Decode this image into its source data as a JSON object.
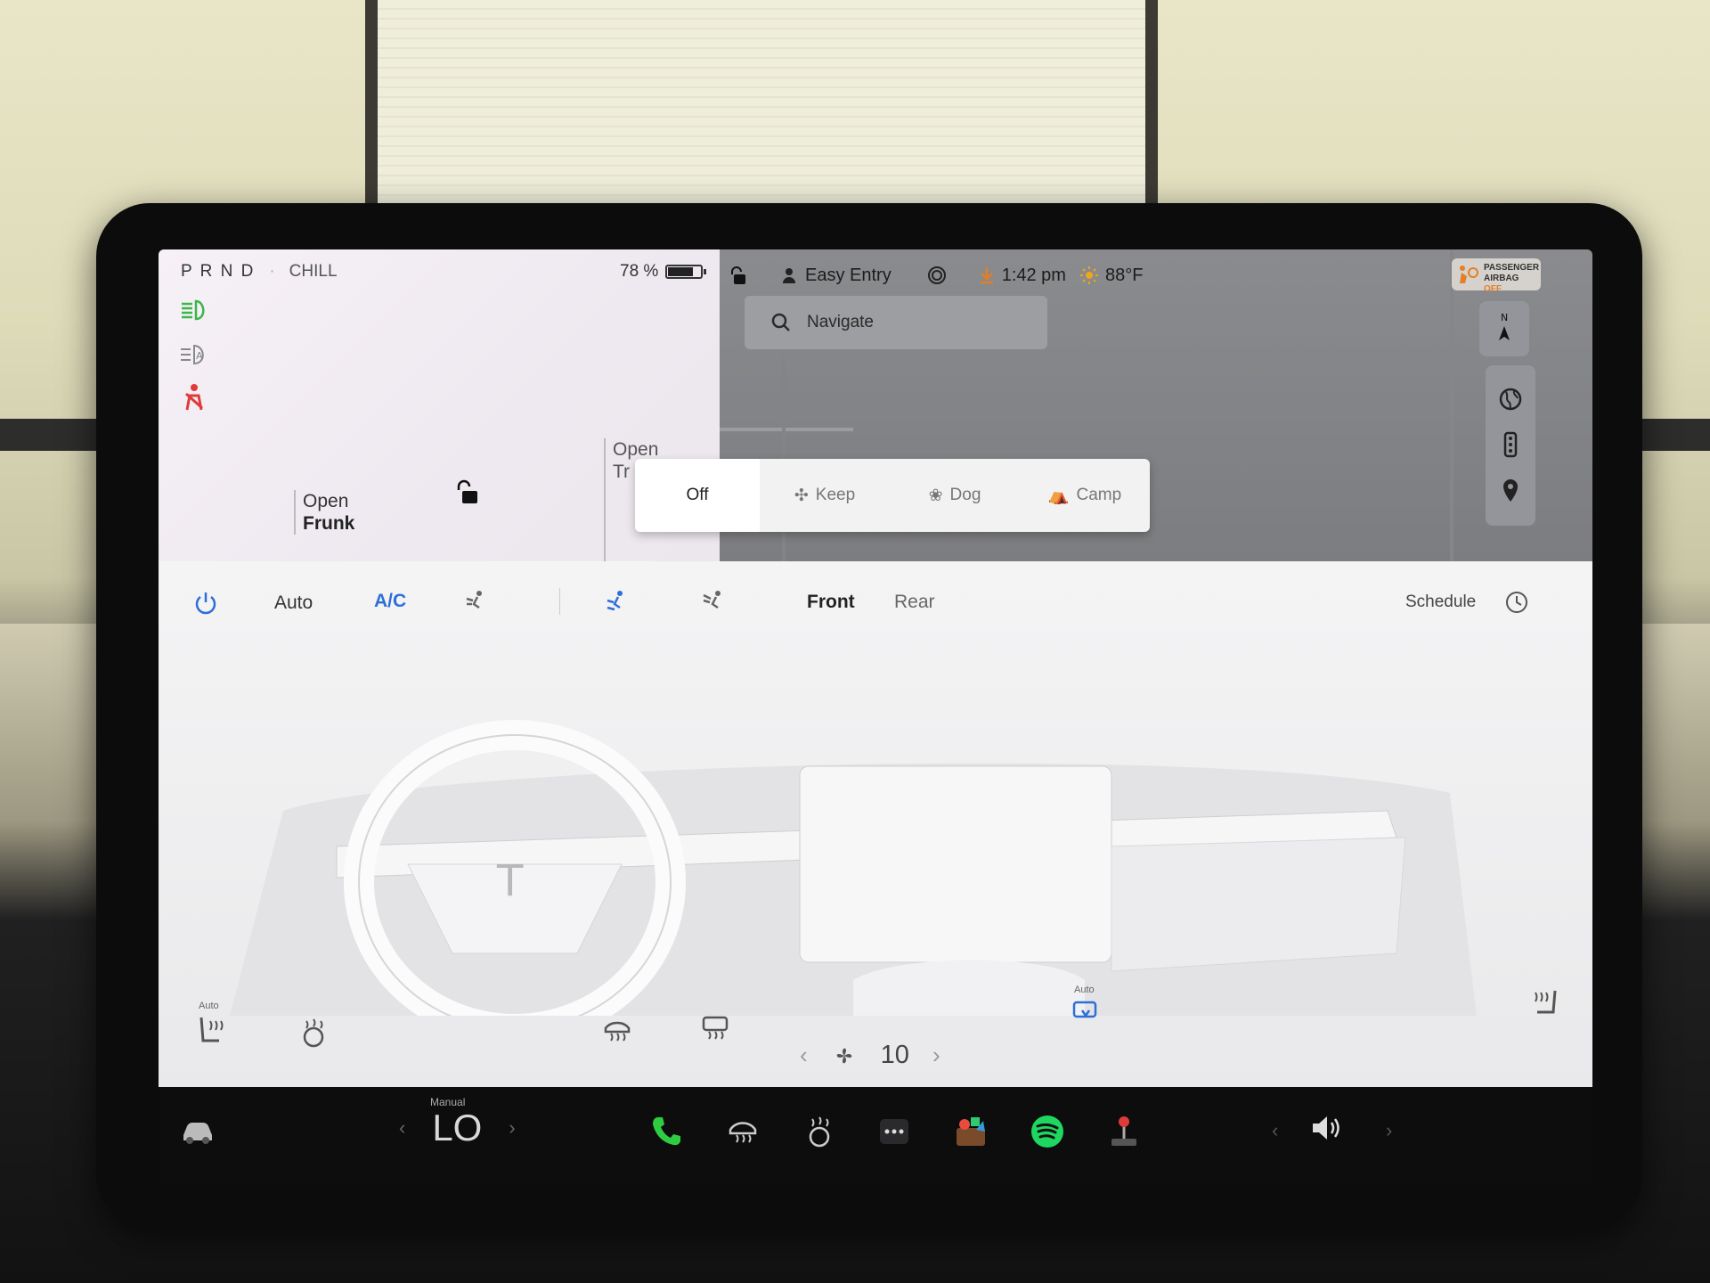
{
  "status": {
    "gears": "P R N D",
    "separator": "·",
    "drive_mode": "CHILL",
    "battery_percent": "78 %",
    "battery_level": 0.78
  },
  "car": {
    "open_frunk_line1": "Open",
    "open_frunk_line2": "Frunk",
    "open_trunk_line1": "Open",
    "open_trunk_line2": "Tr"
  },
  "top_bar": {
    "profile": "Easy Entry",
    "time": "1:42 pm",
    "temperature": "88°F",
    "airbag_line1": "PASSENGER",
    "airbag_line2": "AIRBAG",
    "airbag_state": "OFF"
  },
  "map": {
    "search_placeholder": "Navigate",
    "compass_label": "N"
  },
  "climate_keeper": {
    "options": [
      "Off",
      "Keep",
      "Dog",
      "Camp"
    ],
    "selected": "Off"
  },
  "climate": {
    "auto_label": "Auto",
    "ac_label": "A/C",
    "front_label": "Front",
    "rear_label": "Rear",
    "schedule_label": "Schedule",
    "fan_speed": "10",
    "seat_auto_label": "Auto",
    "recirc_auto_label": "Auto"
  },
  "dock": {
    "temp_mode": "Manual",
    "temp_value": "LO"
  },
  "colors": {
    "accent_blue": "#2d6fd8",
    "headlight_green": "#3cb54a",
    "seatbelt_red": "#e03a3a",
    "spotify_green": "#1ed760",
    "phone_green": "#2ecc40"
  }
}
